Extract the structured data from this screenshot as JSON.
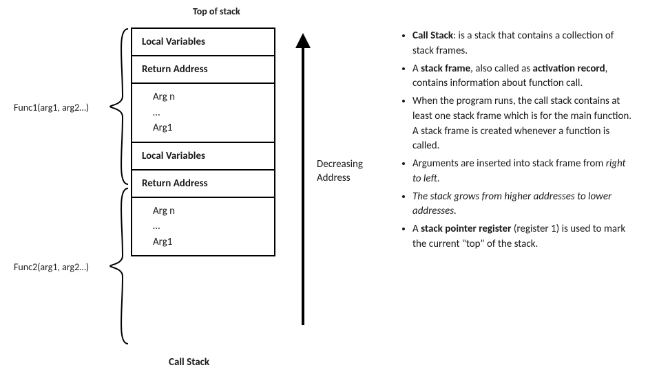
{
  "top_label": "Top of stack",
  "bottom_label": "Call Stack",
  "arrow_label_line1": "Decreasing",
  "arrow_label_line2": "Address",
  "frames": [
    {
      "func_label": "Func1(arg1, arg2…)",
      "local_vars": "Local Variables",
      "return_addr": "Return Address",
      "arg_n": "Arg n",
      "ellipsis": "…",
      "arg_1": "Arg1"
    },
    {
      "func_label": "Func2(arg1, arg2…)",
      "local_vars": "Local Variables",
      "return_addr": "Return Address",
      "arg_n": "Arg n",
      "ellipsis": "…",
      "arg_1": "Arg1"
    }
  ],
  "bullets": {
    "b0_bold": "Call Stack",
    "b0_rest": ": is a stack that contains a collection of stack frames.",
    "b1_a": "A ",
    "b1_bold1": "stack frame",
    "b1_mid": ", also called as ",
    "b1_bold2": "activation record",
    "b1_rest": ", contains information about function call.",
    "b2": "When the program runs, the call stack contains at least one stack frame which is for the main function. A stack frame is created whenever a function is called.",
    "b3_a": "Arguments are inserted into stack frame from ",
    "b3_italic": "right to left",
    "b3_rest": ".",
    "b4_italic": "The stack grows from higher addresses to lower addresses.",
    "b5_a": "A ",
    "b5_bold": "stack pointer register",
    "b5_rest": " (register 1) is used to mark the current \"top\" of the stack."
  }
}
